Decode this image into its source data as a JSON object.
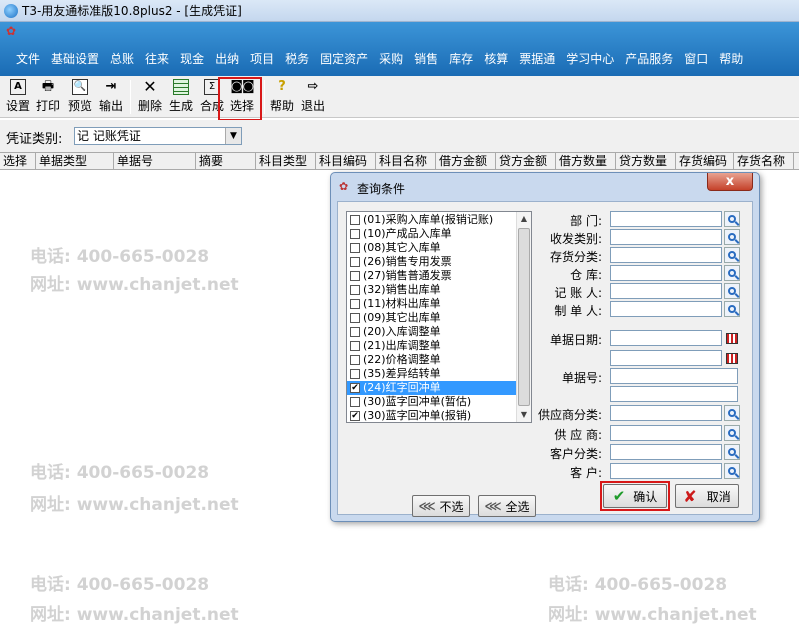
{
  "window": {
    "title": "T3-用友通标准版10.8plus2 - [生成凭证]"
  },
  "menu": [
    "文件",
    "基础设置",
    "总账",
    "往来",
    "现金",
    "出纳",
    "项目",
    "税务",
    "固定资产",
    "采购",
    "销售",
    "库存",
    "核算",
    "票据通",
    "学习中心",
    "产品服务",
    "窗口",
    "帮助"
  ],
  "toolbar": {
    "settings": "设置",
    "print": "打印",
    "preview": "预览",
    "export": "输出",
    "delete": "删除",
    "generate": "生成",
    "merge": "合成",
    "select": "选择",
    "help": "帮助",
    "exit": "退出"
  },
  "voucher": {
    "label": "凭证类别:",
    "value": "记 记账凭证"
  },
  "grid": {
    "columns": [
      "选择",
      "单据类型",
      "单据号",
      "摘要",
      "科目类型",
      "科目编码",
      "科目名称",
      "借方金额",
      "贷方金额",
      "借方数量",
      "贷方数量",
      "存货编码",
      "存货名称"
    ]
  },
  "watermark": {
    "phone": "电话: 400-665-0028",
    "site": "网址: www.chanjet.net"
  },
  "dialog": {
    "title": "查询条件",
    "close": "x",
    "doc_types": [
      {
        "label": "(01)采购入库单(报销记账)",
        "checked": false,
        "selected": false
      },
      {
        "label": "(10)产成品入库单",
        "checked": false,
        "selected": false
      },
      {
        "label": "(08)其它入库单",
        "checked": false,
        "selected": false
      },
      {
        "label": "(26)销售专用发票",
        "checked": false,
        "selected": false
      },
      {
        "label": "(27)销售普通发票",
        "checked": false,
        "selected": false
      },
      {
        "label": "(32)销售出库单",
        "checked": false,
        "selected": false
      },
      {
        "label": "(11)材料出库单",
        "checked": false,
        "selected": false
      },
      {
        "label": "(09)其它出库单",
        "checked": false,
        "selected": false
      },
      {
        "label": "(20)入库调整单",
        "checked": false,
        "selected": false
      },
      {
        "label": "(21)出库调整单",
        "checked": false,
        "selected": false
      },
      {
        "label": "(22)价格调整单",
        "checked": false,
        "selected": false
      },
      {
        "label": "(35)差异结转单",
        "checked": false,
        "selected": false
      },
      {
        "label": "(24)红字回冲单",
        "checked": true,
        "selected": true
      },
      {
        "label": "(30)蓝字回冲单(暂估)",
        "checked": false,
        "selected": false
      },
      {
        "label": "(30)蓝字回冲单(报销)",
        "checked": true,
        "selected": false
      }
    ],
    "deselect_all": "不选",
    "select_all": "全选",
    "fields": {
      "department": "部    门:",
      "receive_type": "收发类别:",
      "inventory_class": "存货分类:",
      "warehouse": "仓    库:",
      "bookkeeper": "记 账 人:",
      "maker": "制 单 人:",
      "doc_date": "单据日期:",
      "doc_no": "单据号:",
      "supplier_class": "供应商分类:",
      "supplier": "供 应 商:",
      "customer_class": "客户分类:",
      "customer": "客    户:"
    },
    "ok": "确认",
    "cancel": "取消"
  }
}
